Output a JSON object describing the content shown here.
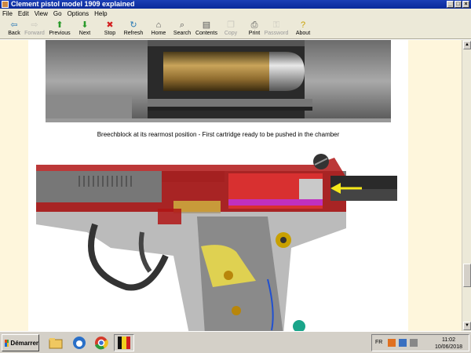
{
  "window": {
    "title": "Clement pistol model 1909 explained"
  },
  "menu": [
    "File",
    "Edit",
    "View",
    "Go",
    "Options",
    "Help"
  ],
  "toolbar": [
    {
      "label": "Back",
      "icon": "back-arrow-icon",
      "glyph": "⇦",
      "color": "#2a7ab5",
      "enabled": true
    },
    {
      "label": "Forward",
      "icon": "forward-arrow-icon",
      "glyph": "⇨",
      "color": "#999999",
      "enabled": false
    },
    {
      "label": "Previous",
      "icon": "up-arrow-icon",
      "glyph": "⬆",
      "color": "#2a9a2a",
      "enabled": true
    },
    {
      "label": "Next",
      "icon": "down-arrow-icon",
      "glyph": "⬇",
      "color": "#2a9a2a",
      "enabled": true
    },
    {
      "label": "Stop",
      "icon": "stop-icon",
      "glyph": "✖",
      "color": "#d22020",
      "enabled": true
    },
    {
      "label": "Refresh",
      "icon": "refresh-icon",
      "glyph": "↻",
      "color": "#2a7ab5",
      "enabled": true
    },
    {
      "label": "Home",
      "icon": "home-icon",
      "glyph": "⌂",
      "color": "#555555",
      "enabled": true
    },
    {
      "label": "Search",
      "icon": "search-icon",
      "glyph": "⌕",
      "color": "#555555",
      "enabled": true
    },
    {
      "label": "Contents",
      "icon": "contents-icon",
      "glyph": "▤",
      "color": "#555555",
      "enabled": true
    },
    {
      "label": "Copy",
      "icon": "copy-icon",
      "glyph": "❐",
      "color": "#999999",
      "enabled": false
    },
    {
      "label": "Print",
      "icon": "print-icon",
      "glyph": "⎙",
      "color": "#555555",
      "enabled": true
    },
    {
      "label": "Password",
      "icon": "password-icon",
      "glyph": "⚿",
      "color": "#999999",
      "enabled": false
    },
    {
      "label": "About",
      "icon": "about-icon",
      "glyph": "?",
      "color": "#c8a000",
      "enabled": true
    }
  ],
  "content": {
    "caption": "Breechblock at its rearmost position - First cartridge ready to be pushed in the chamber"
  },
  "taskbar": {
    "start_label": "Démarrer",
    "apps": [
      "folder-icon",
      "thunderbird-icon",
      "chrome-icon",
      "ebook-app-icon"
    ],
    "language": "FR",
    "time": "11:02",
    "date": "10/06/2018"
  }
}
